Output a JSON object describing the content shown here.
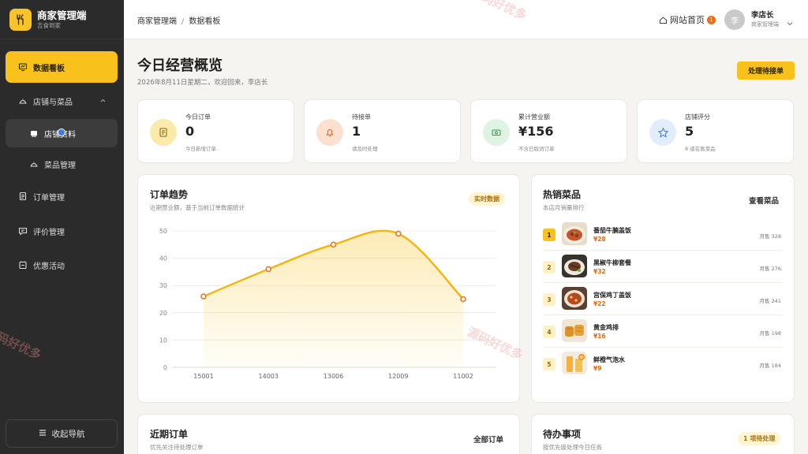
{
  "brand": {
    "title": "商家管理端",
    "subtitle": "吉食到家"
  },
  "sidebar": {
    "items": [
      {
        "label": "数据看板"
      },
      {
        "label": "店铺与菜品"
      },
      {
        "label": "店铺资料"
      },
      {
        "label": "菜品管理"
      },
      {
        "label": "订单管理"
      },
      {
        "label": "评价管理"
      },
      {
        "label": "优惠活动"
      }
    ],
    "collapse_label": "收起导航"
  },
  "topbar": {
    "breadcrumb": [
      "商家管理端",
      "数据看板"
    ],
    "site_home": "网站首页",
    "notice_count": "1",
    "avatar_initial": "李",
    "user_name": "李店长",
    "user_role": "商家管理端"
  },
  "header": {
    "title": "今日经营概览",
    "subtitle": "2026年8月11日星期二，欢迎回来，李店长",
    "primary_action": "处理待接单"
  },
  "stats": [
    {
      "label": "今日订单",
      "value": "0",
      "note": "今日新增订单",
      "color": "#fbeaaa"
    },
    {
      "label": "待接单",
      "value": "1",
      "note": "请及时处理",
      "color": "#fde0cf"
    },
    {
      "label": "累计营业额",
      "value": "¥156",
      "note": "不含已取消订单",
      "color": "#dff3e2"
    },
    {
      "label": "店铺评分",
      "value": "5",
      "note": "8 道在售菜品",
      "color": "#e2edfc"
    }
  ],
  "trend": {
    "title": "订单趋势",
    "subtitle": "近期营业额，基于当前订单数据统计",
    "tag": "实时数据"
  },
  "chart_data": {
    "type": "area",
    "title": "",
    "xlabel": "",
    "ylabel": "",
    "categories": [
      "15001",
      "14003",
      "13006",
      "12009",
      "11002"
    ],
    "values": [
      26,
      36,
      45,
      49,
      25
    ],
    "ylim": [
      0,
      50
    ],
    "yticks": [
      0,
      10,
      20,
      30,
      40,
      50
    ],
    "grid": true,
    "color": "#f5b40b"
  },
  "hot": {
    "title": "热销菜品",
    "subtitle": "本店月销量排行",
    "link": "查看菜品",
    "items": [
      {
        "rank": "1",
        "name": "番茄牛腩盖饭",
        "price": "¥28",
        "sales": "月售 328"
      },
      {
        "rank": "2",
        "name": "黑椒牛柳套餐",
        "price": "¥32",
        "sales": "月售 276"
      },
      {
        "rank": "3",
        "name": "宫保鸡丁盖饭",
        "price": "¥22",
        "sales": "月售 241"
      },
      {
        "rank": "4",
        "name": "黄金鸡排",
        "price": "¥16",
        "sales": "月售 198"
      },
      {
        "rank": "5",
        "name": "鲜橙气泡水",
        "price": "¥9",
        "sales": "月售 184"
      }
    ]
  },
  "recent": {
    "title": "近期订单",
    "subtitle": "优先关注待处理订单",
    "link": "全部订单"
  },
  "todo": {
    "title": "待办事项",
    "subtitle": "按优先级处理今日任务",
    "tag": "1 项待处理"
  },
  "watermark": "源码好优多"
}
